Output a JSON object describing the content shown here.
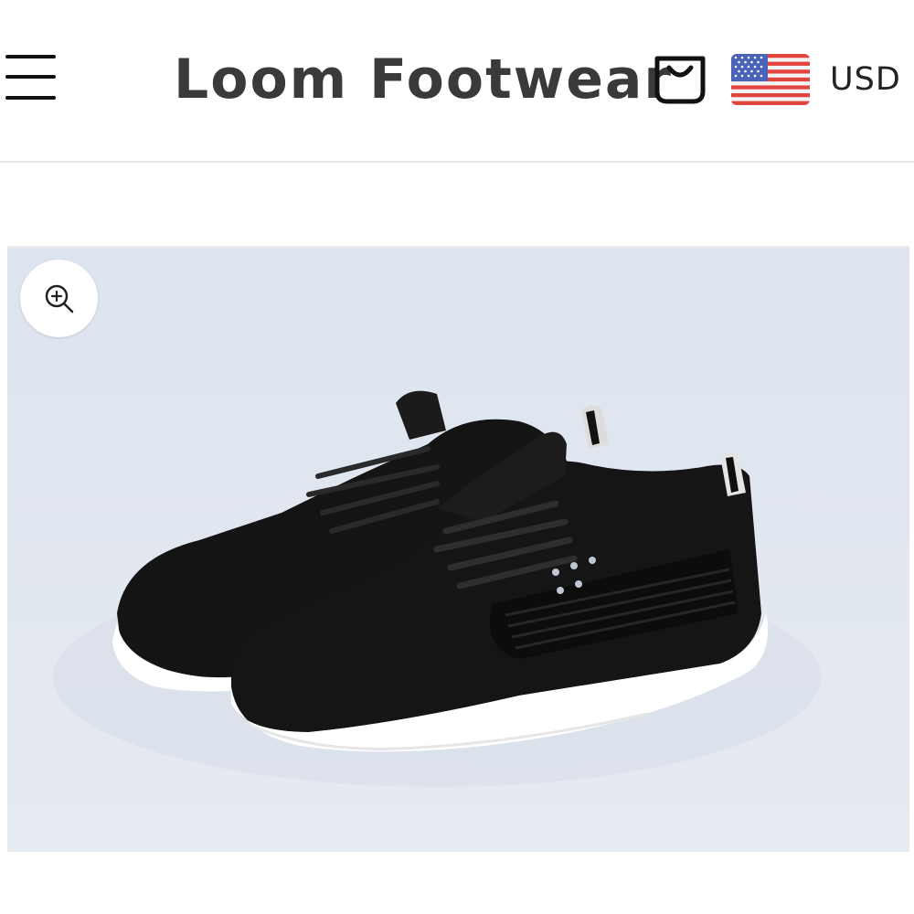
{
  "header": {
    "brand": "Loom Footwear",
    "currency": "USD",
    "menu_icon": "hamburger-menu-icon",
    "cart_icon": "shopping-bag-icon",
    "flag_icon": "us-flag-icon"
  },
  "product": {
    "zoom_icon": "zoom-in-icon",
    "image_subject": "black knit lace-up sneakers"
  },
  "colors": {
    "brand_text": "#3a3a3a",
    "image_background": "#e2e7f1",
    "shoe": "#151515",
    "sole": "#ffffff"
  }
}
